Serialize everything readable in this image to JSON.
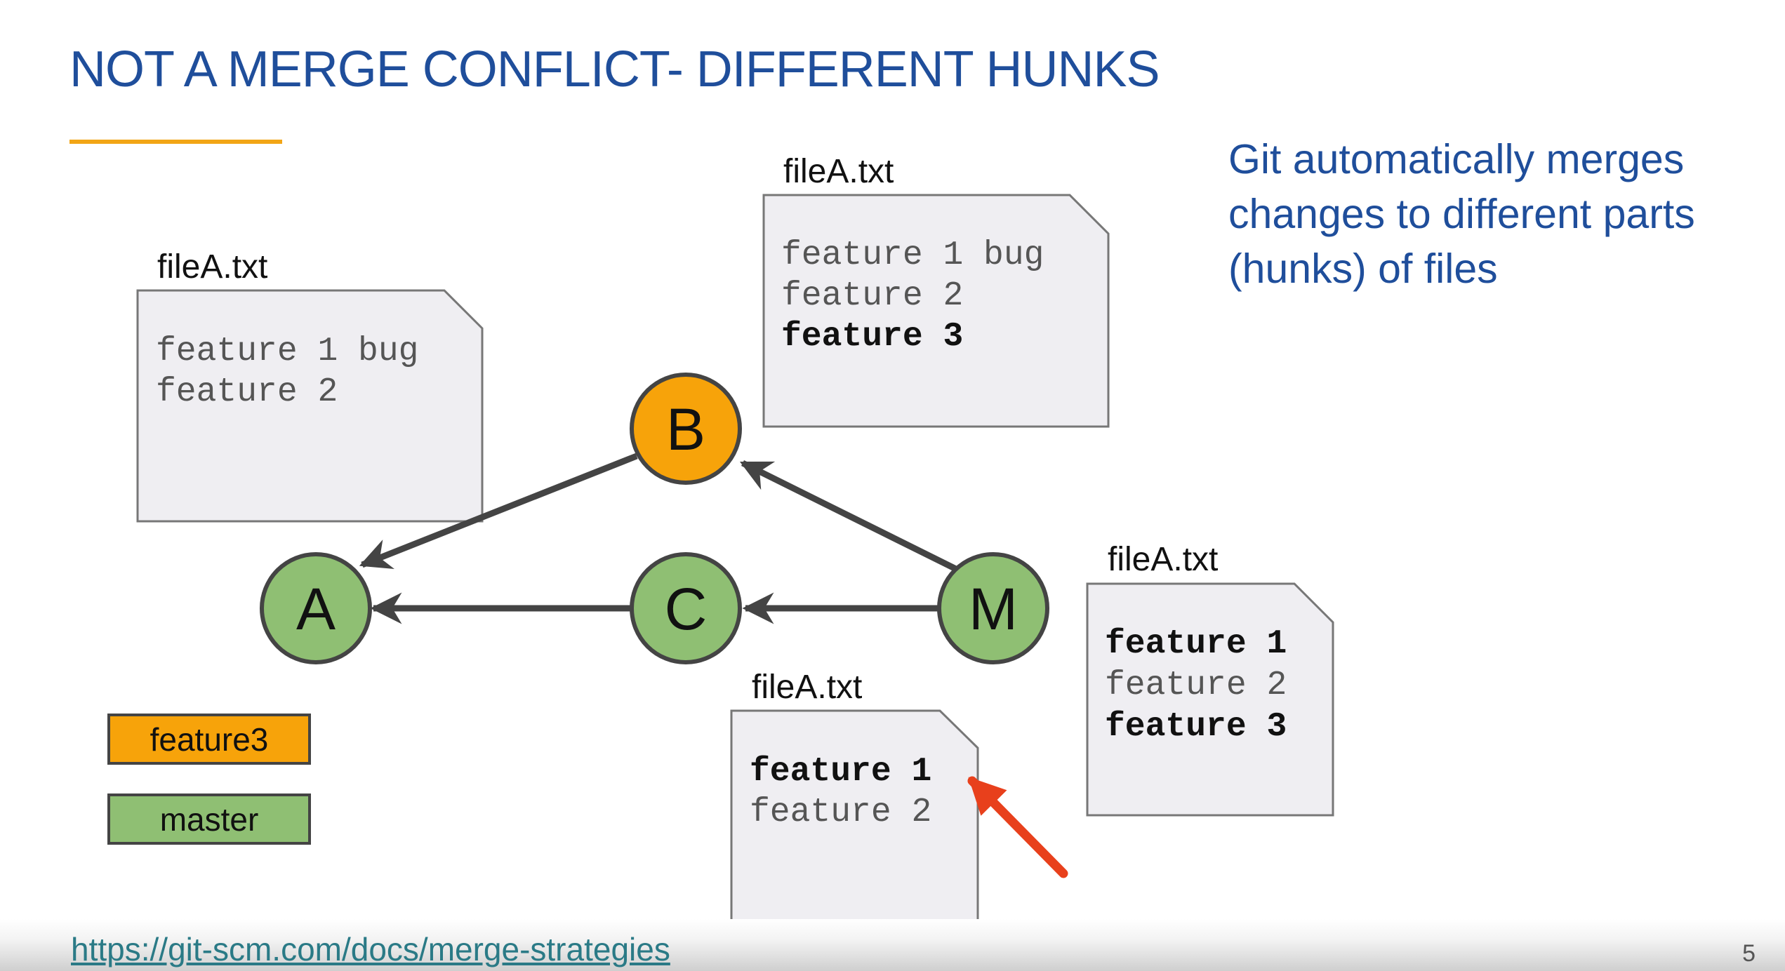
{
  "title": "NOT A MERGE CONFLICT- DIFFERENT HUNKS",
  "colors": {
    "title": "#1f4e9b",
    "accent_line": "#f2a516",
    "feature_branch": "#f7a30a",
    "master_branch": "#8fbf73",
    "arrow_callout": "#e8401c"
  },
  "side_note": "Git automatically merges changes to different parts (hunks) of files",
  "nodes": {
    "a": "A",
    "b": "B",
    "c": "C",
    "m": "M"
  },
  "files": {
    "left": {
      "label": "fileA.txt",
      "lines": [
        {
          "text": "feature 1 bug",
          "bold": false
        },
        {
          "text": "feature 2",
          "bold": false
        }
      ]
    },
    "top": {
      "label": "fileA.txt",
      "lines": [
        {
          "text": "feature 1 bug",
          "bold": false
        },
        {
          "text": "feature 2",
          "bold": false
        },
        {
          "text": "feature 3",
          "bold": true
        }
      ]
    },
    "bottom": {
      "label": "fileA.txt",
      "lines": [
        {
          "text": "feature 1",
          "bold": true
        },
        {
          "text": "feature 2",
          "bold": false
        }
      ]
    },
    "right": {
      "label": "fileA.txt",
      "lines": [
        {
          "text": "feature 1",
          "bold": true
        },
        {
          "text": "feature 2",
          "bold": false
        },
        {
          "text": "feature 3",
          "bold": true
        }
      ]
    }
  },
  "legend": {
    "feature_label": "feature3",
    "master_label": "master"
  },
  "footer": {
    "link": "https://git-scm.com/docs/merge-strategies",
    "page_number": "5"
  }
}
